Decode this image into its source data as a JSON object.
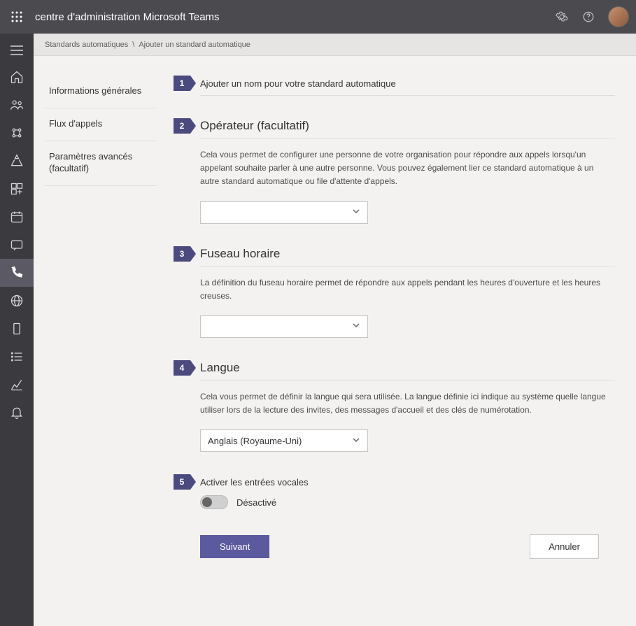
{
  "header": {
    "title": "centre d'administration Microsoft Teams"
  },
  "breadcrumb": {
    "root": "Standards automatiques",
    "current": "Ajouter un standard automatique"
  },
  "leftnav": {
    "items": [
      "Informations générales",
      "Flux d'appels",
      "Paramètres avancés (facultatif)"
    ]
  },
  "steps": {
    "s1": {
      "num": "1",
      "title": "Ajouter un nom pour votre standard automatique"
    },
    "s2": {
      "num": "2",
      "title": "Opérateur (facultatif)",
      "desc": "Cela vous permet de configurer une personne de votre organisation pour répondre aux appels lorsqu'un appelant souhaite parler à une autre personne. Vous pouvez également lier ce standard automatique à un autre standard automatique ou file d'attente d'appels.",
      "value": ""
    },
    "s3": {
      "num": "3",
      "title": "Fuseau horaire",
      "desc": "La définition du fuseau horaire permet de répondre aux appels pendant les heures d'ouverture et les heures creuses.",
      "value": ""
    },
    "s4": {
      "num": "4",
      "title": "Langue",
      "desc": "Cela vous permet de définir la langue qui sera utilisée. La langue définie ici indique au système quelle langue utiliser lors de la lecture des invites, des messages d'accueil et des clés de numérotation.",
      "value": "Anglais (Royaume-Uni)"
    },
    "s5": {
      "num": "5",
      "title": "Activer les entrées vocales",
      "toggle_state": "Désactivé"
    }
  },
  "buttons": {
    "next": "Suivant",
    "cancel": "Annuler"
  }
}
